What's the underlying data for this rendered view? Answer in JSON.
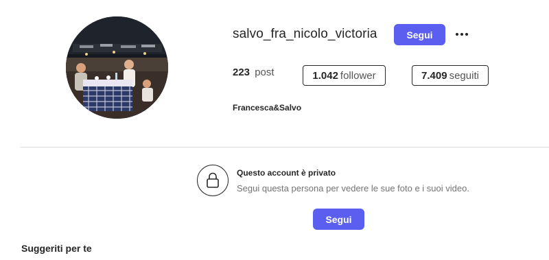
{
  "profile": {
    "username": "salvo_fra_nicolo_victoria",
    "follow_label": "Segui",
    "full_name": "Francesca&Salvo"
  },
  "stats": {
    "posts_value": "223",
    "posts_label": "post",
    "followers_value": "1.042",
    "followers_label": "follower",
    "following_value": "7.409",
    "following_label": "seguiti"
  },
  "private_notice": {
    "title": "Questo account è privato",
    "subtitle": "Segui questa persona per vedere le sue foto e i suoi video.",
    "follow_label": "Segui"
  },
  "suggestions": {
    "heading": "Suggeriti per te"
  },
  "icons": {
    "more": "more-options-icon",
    "lock": "lock-icon"
  },
  "colors": {
    "accent": "#5b5ff0",
    "divider": "#dbdbdb",
    "text": "#262626",
    "muted": "#737373"
  }
}
